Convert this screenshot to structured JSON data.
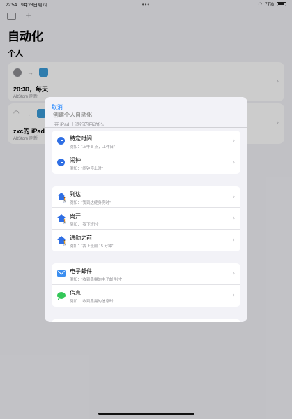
{
  "status_bar": {
    "time": "22:54",
    "date": "9月28日周四",
    "battery": "77%"
  },
  "page": {
    "title": "自动化",
    "section": "个人"
  },
  "automations": [
    {
      "title": "20:30，每天",
      "subtitle": "AltStore 刷新"
    },
    {
      "title": "zxc的 iPad",
      "subtitle": "AltStore 刷新"
    }
  ],
  "sheet": {
    "cancel_label": "取消",
    "header_partial": "创建个人自动化",
    "description": "在 iPad 上运行的自动化。",
    "groups": [
      {
        "items": [
          {
            "icon": "clock-icon",
            "label": "特定时间",
            "hint": "例如：“上午 8 点，工作日”"
          },
          {
            "icon": "alarm-icon",
            "label": "闹钟",
            "hint": "例如：“闹钟停止时”"
          }
        ]
      },
      {
        "items": [
          {
            "icon": "arrive-icon",
            "label": "到达",
            "hint": "例如：“我到达健身房时”"
          },
          {
            "icon": "leave-icon",
            "label": "离开",
            "hint": "例如：“我下班时”"
          },
          {
            "icon": "commute-icon",
            "label": "通勤之前",
            "hint": "例如：“我上班前 15 分钟”"
          }
        ]
      },
      {
        "items": [
          {
            "icon": "mail-icon",
            "label": "电子邮件",
            "hint": "例如：“收到鑫揚的电子邮件时”"
          },
          {
            "icon": "message-icon",
            "label": "信息",
            "hint": "例如：“收到鑫揚的信息时”"
          }
        ]
      }
    ]
  },
  "colors": {
    "accent": "#0a7aff",
    "icon_blue": "#2f6fe4",
    "message_green": "#34c759"
  }
}
